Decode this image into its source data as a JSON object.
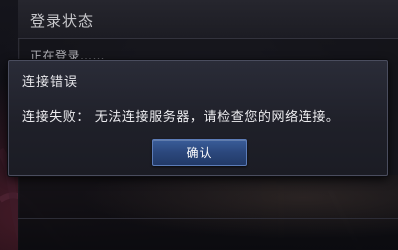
{
  "background_window": {
    "title": "登录状态",
    "status_text": "正在登录……"
  },
  "error_dialog": {
    "title": "连接错误",
    "message": "连接失败： 无法连接服务器，请检查您的网络连接。",
    "confirm_label": "确认"
  },
  "colors": {
    "dialog_bg": "#1f2029",
    "button_blue": "#2b477c",
    "text_light": "#ededf0"
  }
}
